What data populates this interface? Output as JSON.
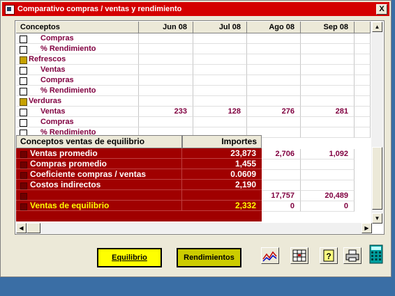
{
  "window": {
    "title": "Comparativo compras / ventas y rendimiento",
    "close_glyph": "X",
    "accent": "#d40000"
  },
  "grid": {
    "columns": [
      "Conceptos",
      "Jun 08",
      "Jul 08",
      "Ago 08",
      "Sep 08"
    ],
    "rows": [
      {
        "label": "Compras",
        "indent": true,
        "checked": false,
        "values": [
          "",
          "",
          "",
          ""
        ]
      },
      {
        "label": "% Rendimiento",
        "indent": true,
        "checked": false,
        "values": [
          "",
          "",
          "",
          ""
        ]
      },
      {
        "label": "Refrescos",
        "indent": false,
        "checked": true,
        "values": [
          "",
          "",
          "",
          ""
        ]
      },
      {
        "label": "Ventas",
        "indent": true,
        "checked": false,
        "values": [
          "",
          "",
          "",
          ""
        ]
      },
      {
        "label": "Compras",
        "indent": true,
        "checked": false,
        "values": [
          "",
          "",
          "",
          ""
        ]
      },
      {
        "label": "% Rendimiento",
        "indent": true,
        "checked": false,
        "values": [
          "",
          "",
          "",
          ""
        ]
      },
      {
        "label": "Verduras",
        "indent": false,
        "checked": true,
        "values": [
          "",
          "",
          "",
          ""
        ]
      },
      {
        "label": "Ventas",
        "indent": true,
        "checked": false,
        "values": [
          "233",
          "128",
          "276",
          "281"
        ]
      },
      {
        "label": "Compras",
        "indent": true,
        "checked": false,
        "values": [
          "",
          "",
          "",
          ""
        ]
      },
      {
        "label": "% Rendimiento",
        "indent": true,
        "checked": false,
        "values": [
          "",
          "",
          "",
          ""
        ]
      }
    ]
  },
  "summary": {
    "headers": [
      "Conceptos ventas de equilibrio",
      "Importes"
    ],
    "rows": [
      {
        "label": "Ventas promedio",
        "value": "23,873",
        "highlight": false
      },
      {
        "label": "Compras promedio",
        "value": "1,455",
        "highlight": false
      },
      {
        "label": "Coeficiente compras / ventas",
        "value": "0.0609",
        "highlight": false
      },
      {
        "label": "Costos indirectos",
        "value": "2,190",
        "highlight": false
      },
      {
        "label": "",
        "value": "",
        "highlight": false
      },
      {
        "label": "Ventas de equilibrio",
        "value": "2,332",
        "highlight": true
      }
    ]
  },
  "grid_extra": {
    "rows": [
      {
        "ago": "2,706",
        "sep": "1,092"
      },
      {
        "ago": "",
        "sep": ""
      },
      {
        "ago": "",
        "sep": ""
      },
      {
        "ago": "",
        "sep": ""
      },
      {
        "ago": "17,757",
        "sep": "20,489"
      },
      {
        "ago": "0",
        "sep": "0"
      }
    ]
  },
  "buttons": {
    "equilibrio": "Equilibrio",
    "rendimientos": "Rendimientos"
  },
  "icons": [
    "chart-icon",
    "grid-icon",
    "help-icon",
    "print-icon",
    "calculator-icon"
  ],
  "colors": {
    "row_text": "#800040",
    "summary_bg": "#a00000",
    "highlight": "#ffff00",
    "btn_yellow": "#ffff00",
    "btn_olive": "#cccc00"
  }
}
